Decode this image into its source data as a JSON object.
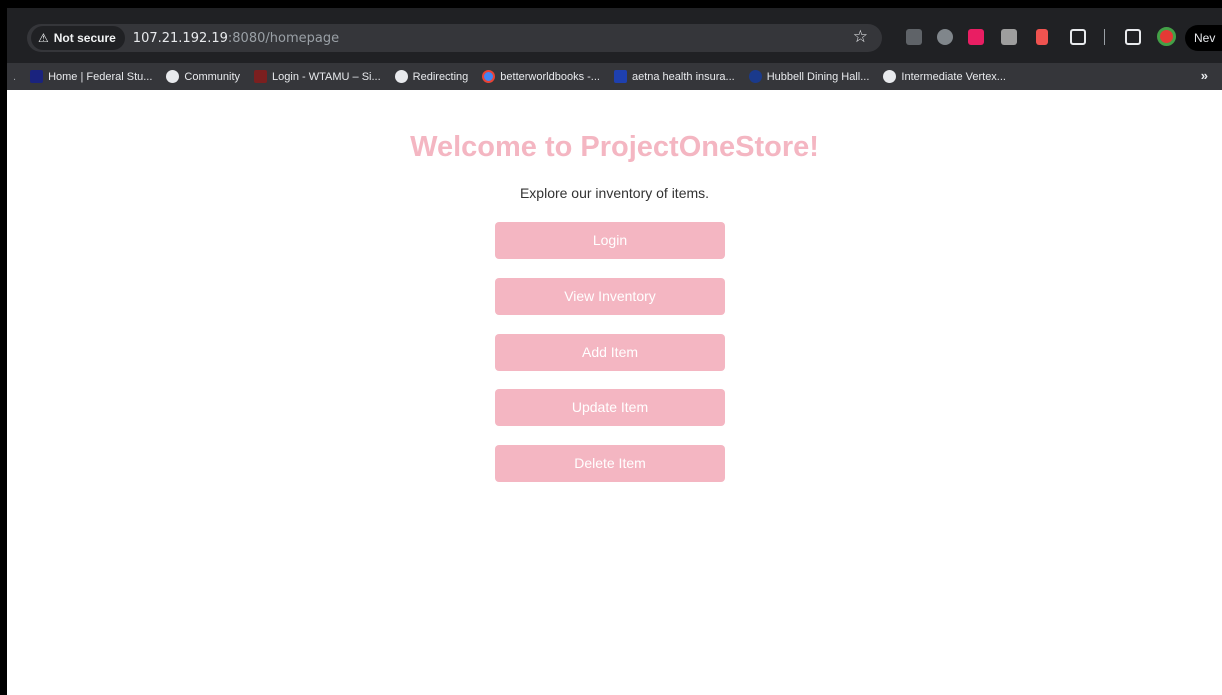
{
  "browser": {
    "security_label": "Not secure",
    "url_host": "107.21.192.19",
    "url_rest": ":8080/homepage",
    "new_chip": "Nev",
    "more_bookmarks": "»",
    "bookmarks": [
      {
        "label": "Home | Federal Stu...",
        "icon": "fsa-icon"
      },
      {
        "label": "Community",
        "icon": "globe-icon"
      },
      {
        "label": "Login - WTAMU – Si...",
        "icon": "wt-icon"
      },
      {
        "label": "Redirecting",
        "icon": "globe-icon"
      },
      {
        "label": "betterworldbooks -...",
        "icon": "google-icon"
      },
      {
        "label": "aetna health insura...",
        "icon": "aetna-icon"
      },
      {
        "label": "Hubbell Dining Hall...",
        "icon": "d-icon"
      },
      {
        "label": "Intermediate Vertex...",
        "icon": "globe-icon"
      }
    ]
  },
  "page": {
    "title": "Welcome to ProjectOneStore!",
    "subtitle": "Explore our inventory of items.",
    "buttons": [
      "Login",
      "View Inventory",
      "Add Item",
      "Update Item",
      "Delete Item"
    ],
    "accent_color": "#f4b6c2"
  }
}
